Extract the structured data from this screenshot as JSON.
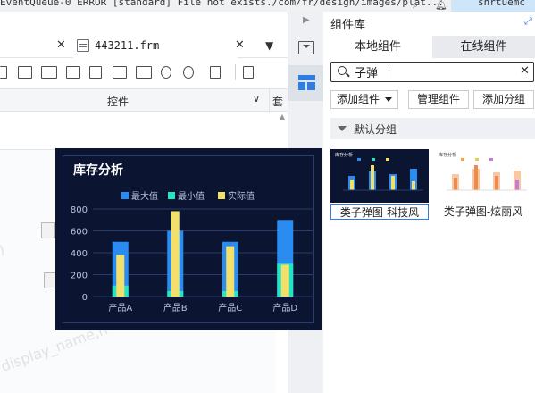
{
  "topbar": {
    "log_text": "EventQueue-0 ERROR [standard] File not exists./com/fr/design/images/plat...",
    "user": "snrtuemc"
  },
  "editor": {
    "tab_file": "443211.frm",
    "widgets_label": "控件",
    "tao_label": "套"
  },
  "panel": {
    "title": "组件库",
    "tab_local": "本地组件",
    "tab_online": "在线组件",
    "search_value": "子弹",
    "add_widget": "添加组件",
    "manage_widget": "管理组件",
    "add_group": "添加分组",
    "group_name": "默认分组",
    "cards": [
      {
        "caption": "类子弹图-科技风"
      },
      {
        "caption": "类子弹图-炫丽风"
      }
    ]
  },
  "watermarks": [
    "l)",
    "display_name,h"
  ],
  "chart_data": {
    "type": "bar",
    "title": "库存分析",
    "categories": [
      "产品A",
      "产品B",
      "产品C",
      "产品D"
    ],
    "series": [
      {
        "name": "最大值",
        "values": [
          500,
          600,
          500,
          700
        ],
        "color": "#2a8cf0"
      },
      {
        "name": "最小值",
        "values": [
          100,
          50,
          50,
          300
        ],
        "color": "#25e3c3"
      },
      {
        "name": "实际值",
        "values": [
          380,
          780,
          460,
          290
        ],
        "color": "#f2e06b"
      }
    ],
    "yticks": [
      0,
      200,
      400,
      600,
      800
    ],
    "ylim": [
      0,
      800
    ],
    "legend": "top-center",
    "background": "#0b1430"
  }
}
